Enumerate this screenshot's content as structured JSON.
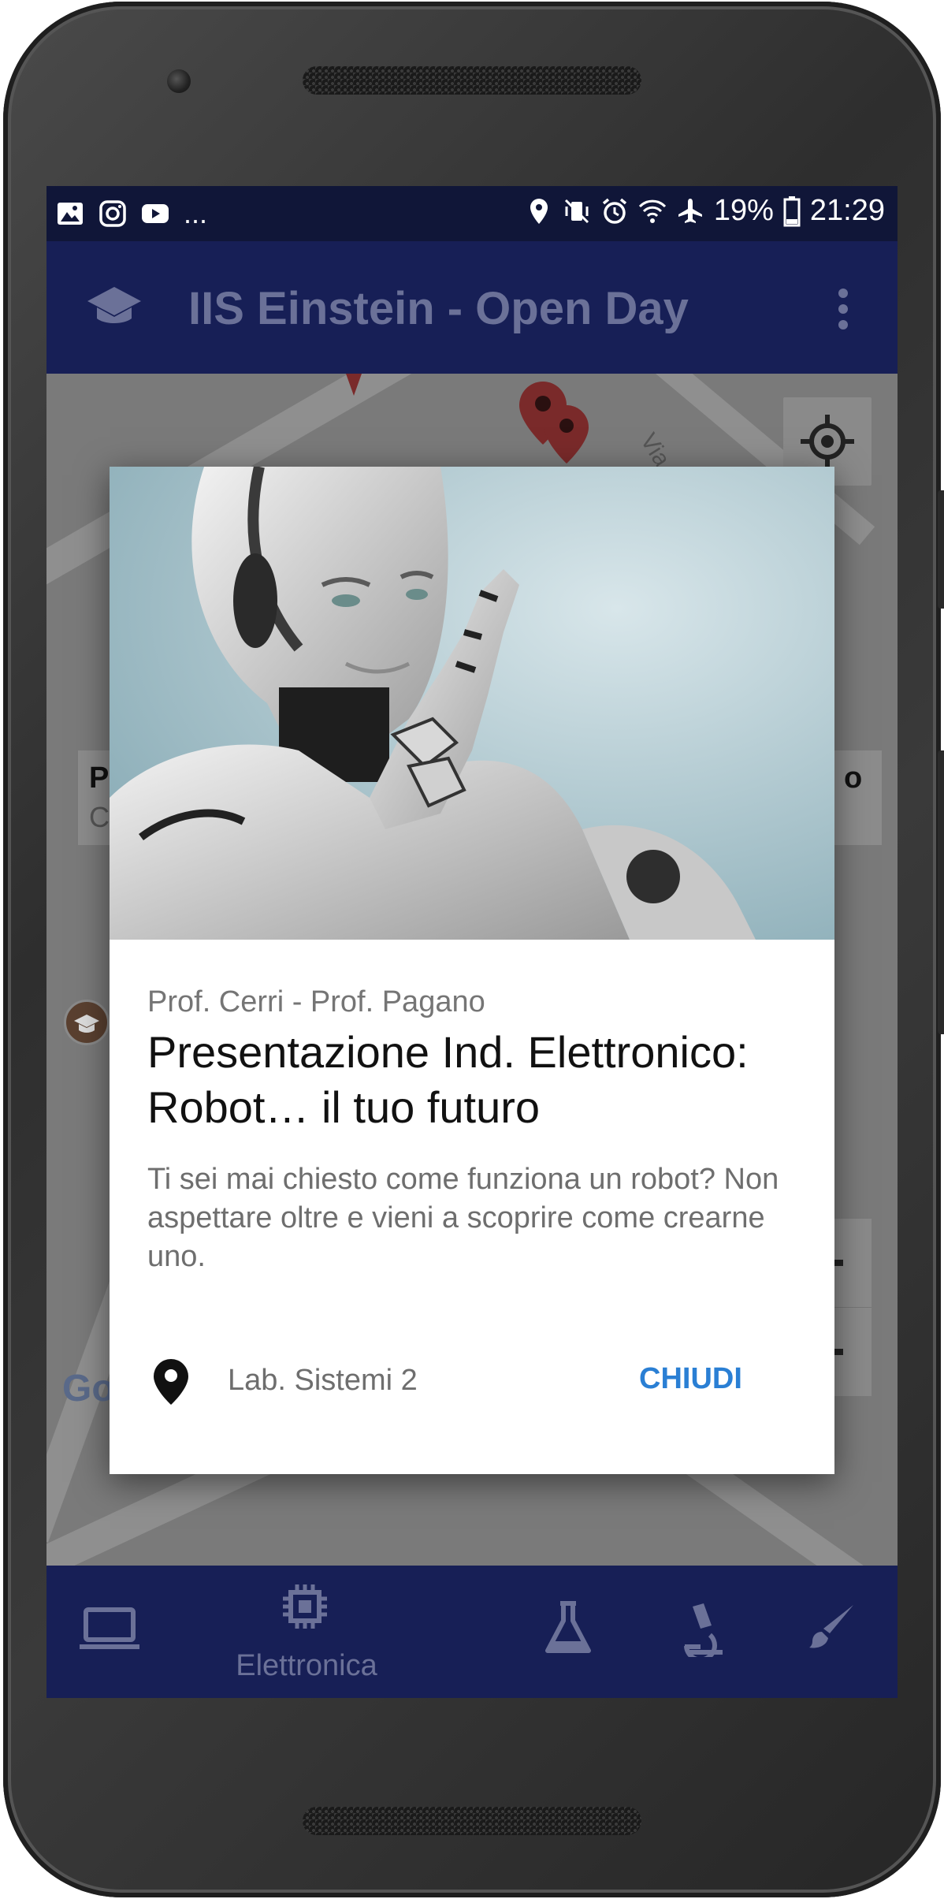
{
  "status_bar": {
    "notification_icons": [
      "image-icon",
      "instagram-icon",
      "youtube-icon"
    ],
    "more": "...",
    "battery": "19%",
    "time": "21:29"
  },
  "app_bar": {
    "title": "IIS Einstein - Open Day"
  },
  "map": {
    "street_label": "Via P. Ra",
    "attribution": "Google",
    "card_left_title": "P",
    "card_left_sub": "C",
    "card_right_text": "o"
  },
  "dialog": {
    "speakers": "Prof. Cerri - Prof. Pagano",
    "title": "Presentazione Ind. Elettronico: Robot… il tuo futuro",
    "body": "Ti sei mai chiesto come funziona un robot? Non aspettare oltre e vieni a scoprire come crearne uno.",
    "location": "Lab. Sistemi 2",
    "close_label": "CHIUDI"
  },
  "bottom_nav": {
    "items": [
      {
        "icon": "laptop-icon",
        "label": ""
      },
      {
        "icon": "chip-icon",
        "label": "Elettronica"
      },
      {
        "icon": "flask-icon",
        "label": ""
      },
      {
        "icon": "microscope-icon",
        "label": ""
      },
      {
        "icon": "brush-icon",
        "label": ""
      }
    ],
    "active_label": "Elettronica"
  },
  "colors": {
    "primary": "#171f56",
    "status_bar": "#101638",
    "accent": "#2a7fd4"
  }
}
